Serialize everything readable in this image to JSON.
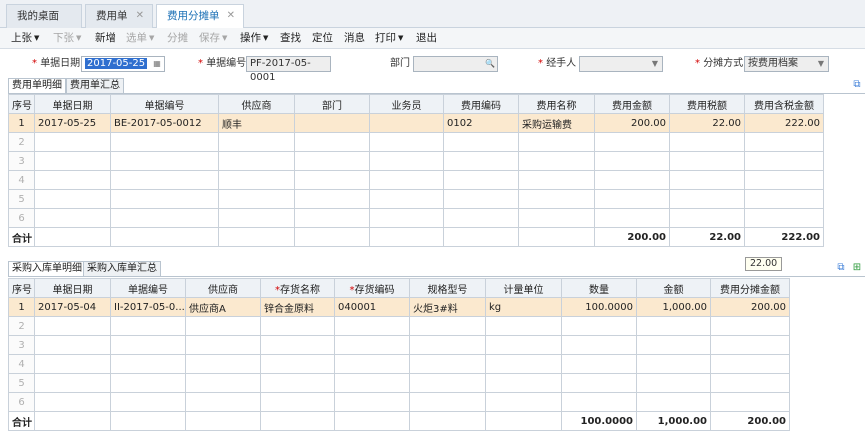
{
  "tabs": [
    {
      "label": "我的桌面",
      "closable": false
    },
    {
      "label": "费用单",
      "closable": true
    },
    {
      "label": "费用分摊单",
      "closable": true
    }
  ],
  "toolbar": {
    "prev": "上张",
    "next": "下张",
    "new": "新增",
    "select": "选单",
    "allocate": "分摊",
    "save": "保存",
    "operate": "操作",
    "search": "查找",
    "locate": "定位",
    "message": "消息",
    "print": "打印",
    "exit": "退出"
  },
  "header": {
    "date_label": "单据日期",
    "date_value": "2017-05-25",
    "bill_no_label": "单据编号",
    "bill_no_value": "PF-2017-05-0001",
    "dept_label": "部门",
    "dept_value": "",
    "handler_label": "经手人",
    "handler_value": "",
    "method_label": "分摊方式",
    "method_value": "按费用档案"
  },
  "upper": {
    "tab_detail": "费用单明细",
    "tab_summary": "费用单汇总",
    "columns": [
      "序号",
      "单据日期",
      "单据编号",
      "供应商",
      "部门",
      "业务员",
      "费用编码",
      "费用名称",
      "费用金额",
      "费用税额",
      "费用含税金额"
    ],
    "rows": [
      [
        "1",
        "2017-05-25",
        "BE-2017-05-0012",
        "顺丰",
        "",
        "",
        "0102",
        "采购运输费",
        "200.00",
        "22.00",
        "222.00"
      ],
      [
        "2",
        "",
        "",
        "",
        "",
        "",
        "",
        "",
        "",
        "",
        ""
      ],
      [
        "3",
        "",
        "",
        "",
        "",
        "",
        "",
        "",
        "",
        "",
        ""
      ],
      [
        "4",
        "",
        "",
        "",
        "",
        "",
        "",
        "",
        "",
        "",
        ""
      ],
      [
        "5",
        "",
        "",
        "",
        "",
        "",
        "",
        "",
        "",
        "",
        ""
      ],
      [
        "6",
        "",
        "",
        "",
        "",
        "",
        "",
        "",
        "",
        "",
        ""
      ]
    ],
    "total": [
      "合计",
      "",
      "",
      "",
      "",
      "",
      "",
      "",
      "200.00",
      "22.00",
      "222.00"
    ]
  },
  "tooltip": "22.00",
  "lower": {
    "tab_detail": "采购入库单明细",
    "tab_summary": "采购入库单汇总",
    "columns": [
      "序号",
      "单据日期",
      "单据编号",
      "供应商",
      "存货名称",
      "存货编码",
      "规格型号",
      "计量单位",
      "数量",
      "金额",
      "费用分摊金额"
    ],
    "rows": [
      [
        "1",
        "2017-05-04",
        "II-2017-05-0...",
        "供应商A",
        "锌合金原料",
        "040001",
        "火炬3#料",
        "kg",
        "100.0000",
        "1,000.00",
        "200.00"
      ],
      [
        "2",
        "",
        "",
        "",
        "",
        "",
        "",
        "",
        "",
        "",
        ""
      ],
      [
        "3",
        "",
        "",
        "",
        "",
        "",
        "",
        "",
        "",
        "",
        ""
      ],
      [
        "4",
        "",
        "",
        "",
        "",
        "",
        "",
        "",
        "",
        "",
        ""
      ],
      [
        "5",
        "",
        "",
        "",
        "",
        "",
        "",
        "",
        "",
        "",
        ""
      ],
      [
        "6",
        "",
        "",
        "",
        "",
        "",
        "",
        "",
        "",
        "",
        ""
      ]
    ],
    "total": [
      "合计",
      "",
      "",
      "",
      "",
      "",
      "",
      "",
      "100.0000",
      "1,000.00",
      "200.00"
    ]
  }
}
